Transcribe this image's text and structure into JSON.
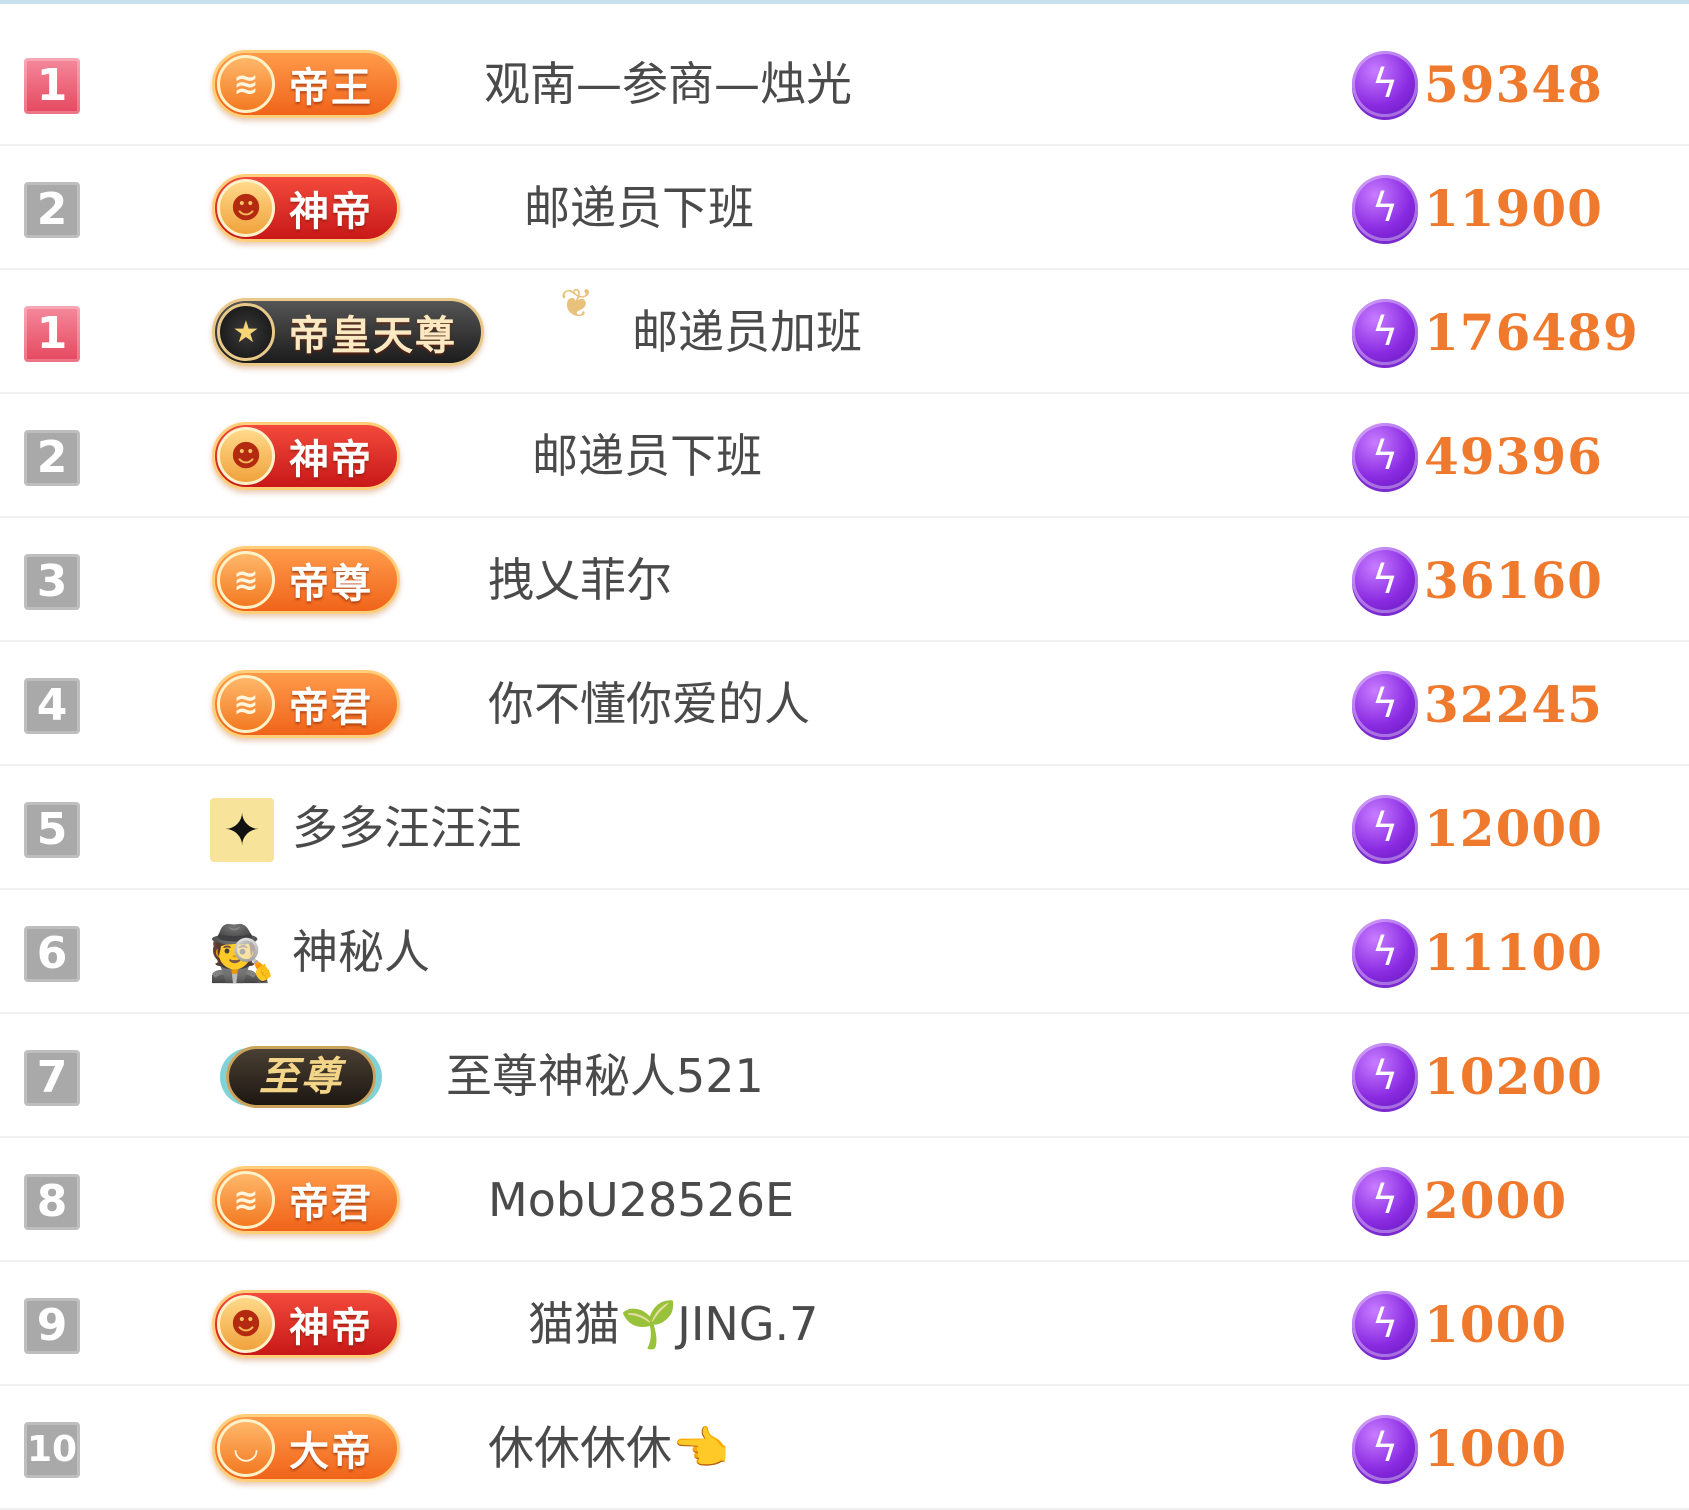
{
  "rows": [
    {
      "rank": "1",
      "rank_style": "top",
      "badge": {
        "kind": "orange",
        "label": "帝王",
        "emblem": "≋"
      },
      "name": "观南—参商—烛光",
      "score": "59348"
    },
    {
      "rank": "2",
      "rank_style": "normal",
      "badge": {
        "kind": "red",
        "label": "神帝",
        "emblem": "☻"
      },
      "name": "邮递员下班",
      "score": "11900"
    },
    {
      "rank": "1",
      "rank_style": "top",
      "badge": {
        "kind": "dark",
        "label": "帝皇天尊",
        "emblem": "★"
      },
      "name": "邮递员加班",
      "score": "176489"
    },
    {
      "rank": "2",
      "rank_style": "normal",
      "badge": {
        "kind": "red",
        "label": "神帝",
        "emblem": "☻"
      },
      "name": "邮递员下班",
      "score": "49396"
    },
    {
      "rank": "3",
      "rank_style": "normal",
      "badge": {
        "kind": "orange",
        "label": "帝尊",
        "emblem": "≋"
      },
      "name": "拽乂菲尔",
      "score": "36160"
    },
    {
      "rank": "4",
      "rank_style": "normal",
      "badge": {
        "kind": "orange",
        "label": "帝君",
        "emblem": "≋"
      },
      "name": "你不懂你爱的人",
      "score": "32245"
    },
    {
      "rank": "5",
      "rank_style": "normal",
      "avatar": {
        "kind": "yellow",
        "icon": "✦"
      },
      "name": "多多汪汪汪",
      "score": "12000"
    },
    {
      "rank": "6",
      "rank_style": "normal",
      "avatar": {
        "kind": "plain",
        "icon": "🕵"
      },
      "name": "神秘人",
      "score": "11100"
    },
    {
      "rank": "7",
      "rank_style": "normal",
      "zhizun": "至尊",
      "name": "至尊神秘人521",
      "score": "10200"
    },
    {
      "rank": "8",
      "rank_style": "normal",
      "badge": {
        "kind": "orange",
        "label": "帝君",
        "emblem": "≋"
      },
      "name": "MobU28526E",
      "score": "2000"
    },
    {
      "rank": "9",
      "rank_style": "normal",
      "badge": {
        "kind": "red",
        "label": "神帝",
        "emblem": "☻"
      },
      "name": "猫猫🌱JING.7",
      "score": "1000"
    },
    {
      "rank": "10",
      "rank_style": "normal",
      "badge": {
        "kind": "orange",
        "label": "大帝",
        "emblem": "◡"
      },
      "name": "休休休休👈",
      "score": "1000"
    }
  ],
  "colors": {
    "score": "#ef7a2e",
    "rank_top": "#e5475f",
    "rank_normal": "#a9a9a9",
    "bolt": "#8a2be2"
  },
  "icons": {
    "currency": "lightning-bolt-icon"
  }
}
